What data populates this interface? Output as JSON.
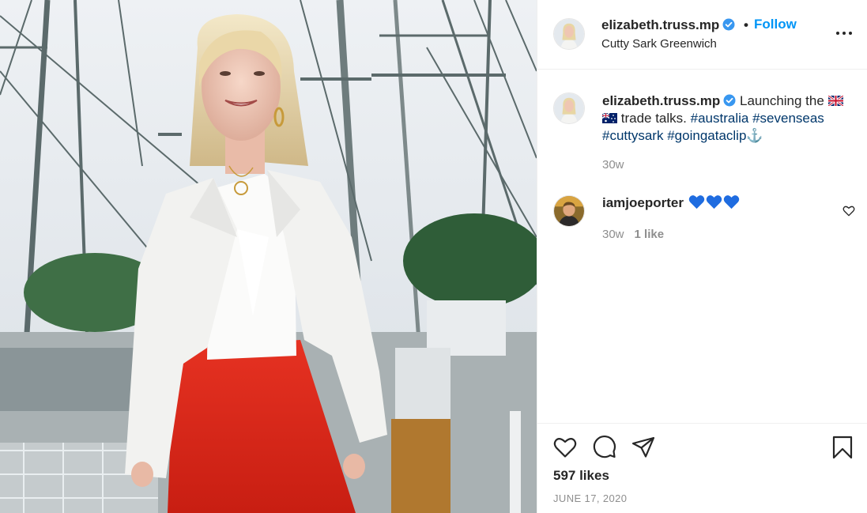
{
  "post": {
    "username": "elizabeth.truss.mp",
    "verified": true,
    "follow_label": "Follow",
    "separator": "•",
    "location": "Cutty Sark Greenwich",
    "likes": "597 likes",
    "date": "JUNE 17, 2020"
  },
  "caption": {
    "username": "elizabeth.truss.mp",
    "text_before": "Launching the",
    "text_middle": "trade talks.",
    "flags": [
      "uk-flag",
      "australia-flag"
    ],
    "hashtags": [
      "#australia",
      "#sevenseas",
      "#cuttysark",
      "#goingataclip"
    ],
    "trailing_emoji": "⚓",
    "time": "30w"
  },
  "comment": {
    "username": "iamjoeporter",
    "emoji": [
      "blue-heart",
      "blue-heart",
      "blue-heart"
    ],
    "time": "30w",
    "likes": "1 like"
  },
  "icons": {
    "like": "heart-outline-icon",
    "comment": "speech-bubble-icon",
    "share": "paper-plane-icon",
    "save": "bookmark-icon",
    "more": "ellipsis-icon",
    "verified": "verified-badge-icon"
  },
  "colors": {
    "link": "#0095f6",
    "hashtag": "#00376b",
    "verified": "#3897f0",
    "muted": "#8e8e8e",
    "text": "#262626",
    "blazer": "#f4f4f2",
    "trousers": "#e2291c"
  }
}
